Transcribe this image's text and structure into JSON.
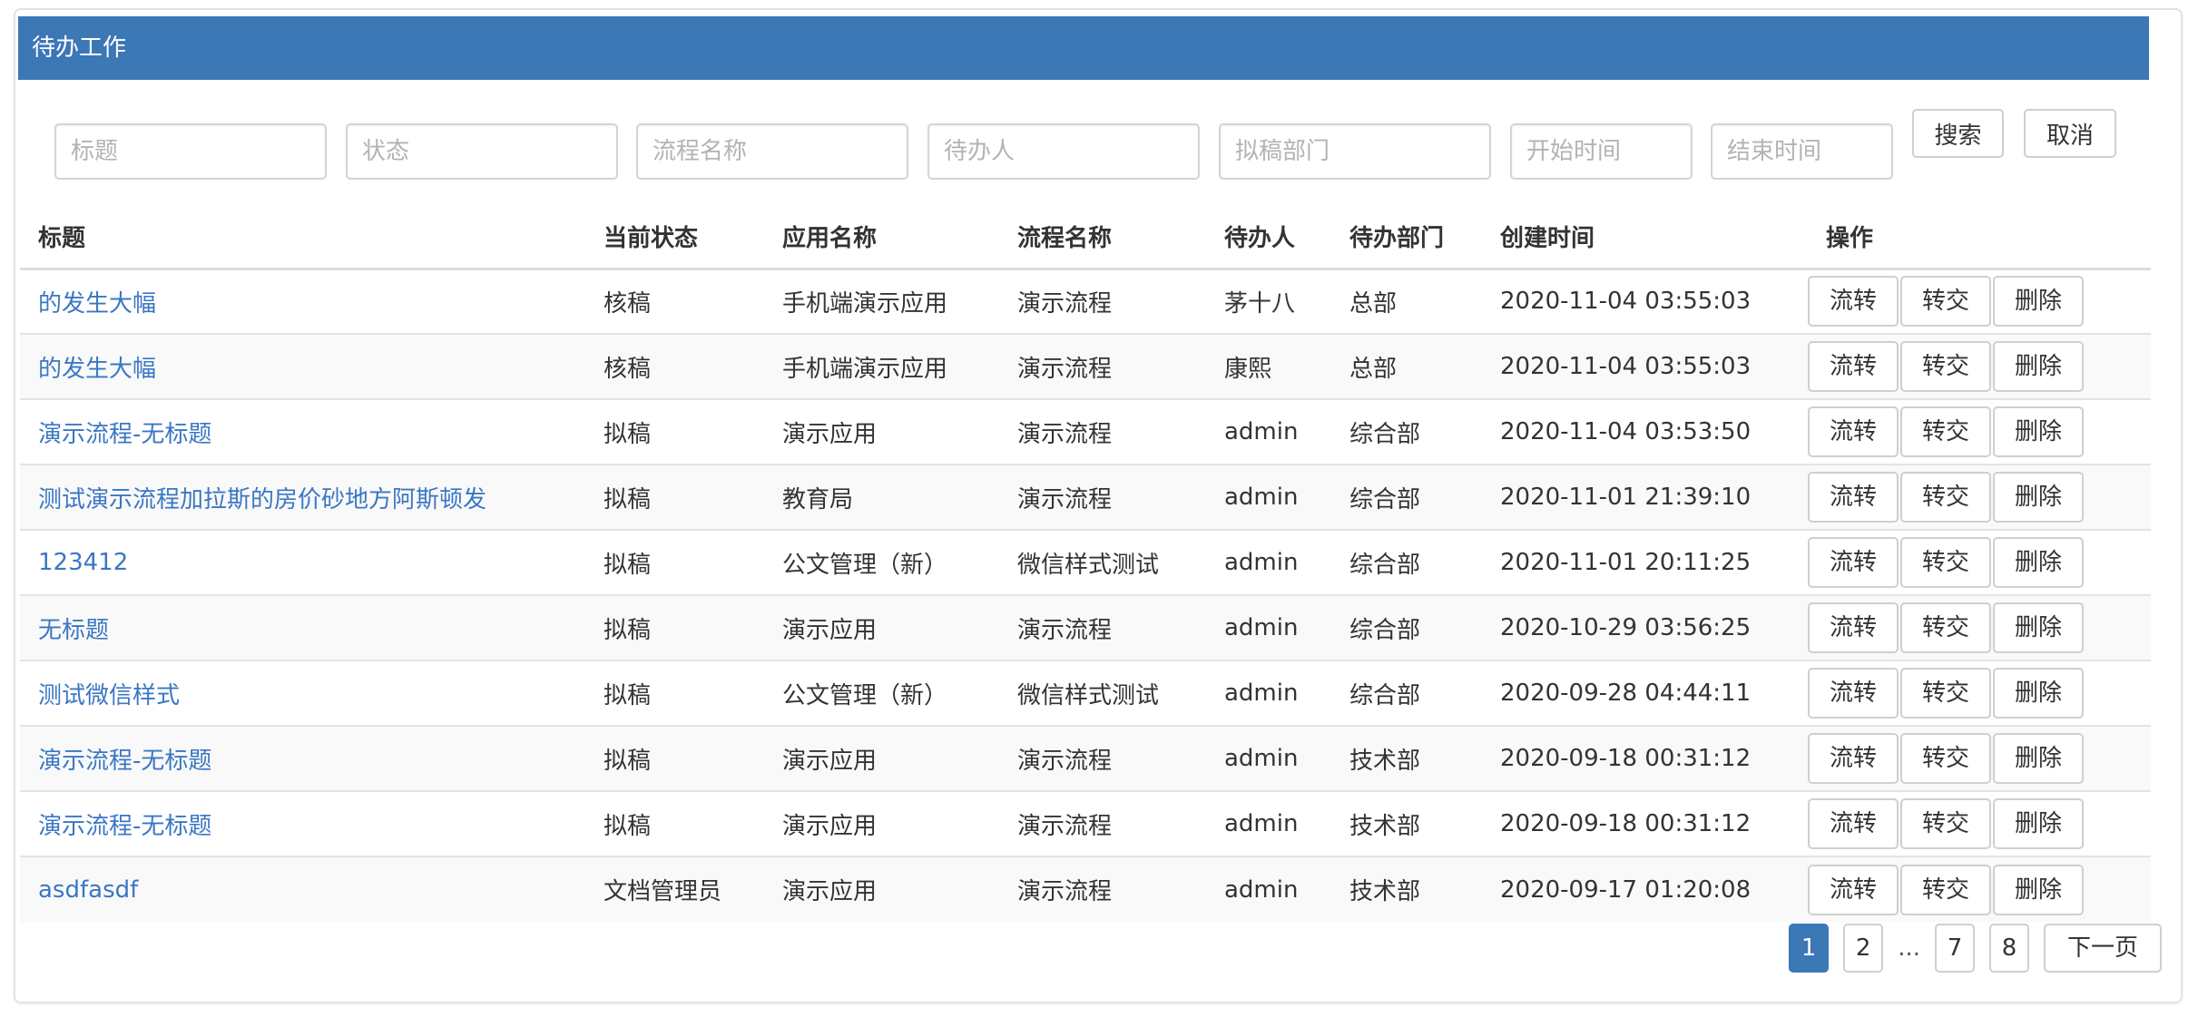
{
  "panel": {
    "title": "待办工作"
  },
  "search": {
    "title_placeholder": "标题",
    "status_placeholder": "状态",
    "process_placeholder": "流程名称",
    "assignee_placeholder": "待办人",
    "dept_placeholder": "拟稿部门",
    "start_placeholder": "开始时间",
    "end_placeholder": "结束时间",
    "search_label": "搜索",
    "cancel_label": "取消"
  },
  "table": {
    "headers": [
      "标题",
      "当前状态",
      "应用名称",
      "流程名称",
      "待办人",
      "待办部门",
      "创建时间",
      "操作"
    ],
    "actions": {
      "flow": "流转",
      "transfer": "转交",
      "delete": "删除"
    },
    "rows": [
      {
        "title": "的发生大幅",
        "status": "核稿",
        "app": "手机端演示应用",
        "process": "演示流程",
        "assignee": "茅十八",
        "dept": "总部",
        "created": "2020-11-04 03:55:03"
      },
      {
        "title": "的发生大幅",
        "status": "核稿",
        "app": "手机端演示应用",
        "process": "演示流程",
        "assignee": "康熙",
        "dept": "总部",
        "created": "2020-11-04 03:55:03"
      },
      {
        "title": "演示流程-无标题",
        "status": "拟稿",
        "app": "演示应用",
        "process": "演示流程",
        "assignee": "admin",
        "dept": "综合部",
        "created": "2020-11-04 03:53:50"
      },
      {
        "title": "测试演示流程加拉斯的房价砂地方阿斯顿发",
        "status": "拟稿",
        "app": "教育局",
        "process": "演示流程",
        "assignee": "admin",
        "dept": "综合部",
        "created": "2020-11-01 21:39:10"
      },
      {
        "title": "123412",
        "status": "拟稿",
        "app": "公文管理（新）",
        "process": "微信样式测试",
        "assignee": "admin",
        "dept": "综合部",
        "created": "2020-11-01 20:11:25"
      },
      {
        "title": "无标题",
        "status": "拟稿",
        "app": "演示应用",
        "process": "演示流程",
        "assignee": "admin",
        "dept": "综合部",
        "created": "2020-10-29 03:56:25"
      },
      {
        "title": "测试微信样式",
        "status": "拟稿",
        "app": "公文管理（新）",
        "process": "微信样式测试",
        "assignee": "admin",
        "dept": "综合部",
        "created": "2020-09-28 04:44:11"
      },
      {
        "title": "演示流程-无标题",
        "status": "拟稿",
        "app": "演示应用",
        "process": "演示流程",
        "assignee": "admin",
        "dept": "技术部",
        "created": "2020-09-18 00:31:12"
      },
      {
        "title": "演示流程-无标题",
        "status": "拟稿",
        "app": "演示应用",
        "process": "演示流程",
        "assignee": "admin",
        "dept": "技术部",
        "created": "2020-09-18 00:31:12"
      },
      {
        "title": "asdfasdf",
        "status": "文档管理员",
        "app": "演示应用",
        "process": "演示流程",
        "assignee": "admin",
        "dept": "技术部",
        "created": "2020-09-17 01:20:08"
      }
    ]
  },
  "pagination": {
    "pages": [
      "1",
      "2",
      "7",
      "8"
    ],
    "current": "1",
    "ellipsis": "...",
    "next_label": "下一页"
  },
  "colors": {
    "header_bg": "#3c77b6",
    "link": "#3a77c4"
  }
}
